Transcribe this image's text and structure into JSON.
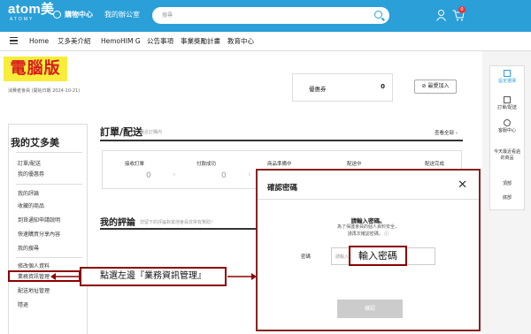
{
  "topbar": {
    "logo": "atom美",
    "logo_sub": "ATOMY",
    "shopping_center": "購物中心",
    "my_office": "我的辦公室",
    "search_placeholder": "搜尋",
    "cart_count": "0"
  },
  "navbar": {
    "items": [
      "Home",
      "艾多美介紹",
      "HemoHIM G",
      "公告事項",
      "事業獎勵計畫",
      "教育中心"
    ]
  },
  "pc_tag": "電腦版",
  "member_text": "消費者會員 (開始日期 2024-10-21)",
  "coupon": {
    "label": "優惠券",
    "value": "0"
  },
  "favorite_btn": "⊘ 最愛加入",
  "sidebar": {
    "title": "我的艾多美",
    "items": [
      "訂單/配送",
      "我的優惠券",
      "我的評論",
      "收藏的商品",
      "到貨通知申請說明",
      "快速購買分享內容",
      "我的搜尋",
      "修改個人資料",
      "業務資訊管理",
      "配送地址管理",
      "隱退"
    ]
  },
  "orders": {
    "title": "訂單/配送",
    "subtitle": "最近訂購內",
    "view_all": "查看全部 ›",
    "statuses": [
      {
        "label": "接收訂單",
        "value": "0"
      },
      {
        "label": "付款成功",
        "value": "0"
      },
      {
        "label": "商品準備中",
        "value": ""
      },
      {
        "label": "配送中",
        "value": ""
      },
      {
        "label": "配送完成",
        "value": ""
      }
    ]
  },
  "review": {
    "title": "我的評論",
    "subtitle": "您留下的評論對其他會員非常有幫助！"
  },
  "annotation": "點選左邊『業務資訊管理』",
  "right_sidebar": {
    "items": [
      "設定選擇",
      "訂單/配送",
      "客服中心",
      "今天最近看過的商品",
      "頂部",
      "底部"
    ]
  },
  "modal": {
    "title": "確認密碼",
    "heading": "請輸入密碼。",
    "desc1": "為了保護會員的個人資料安全，",
    "desc2": "請再次確認密碼。 ⓘ",
    "label": "密碼",
    "placeholder": "請輸入密碼",
    "callout": "輸入密碼",
    "confirm": "確認"
  }
}
